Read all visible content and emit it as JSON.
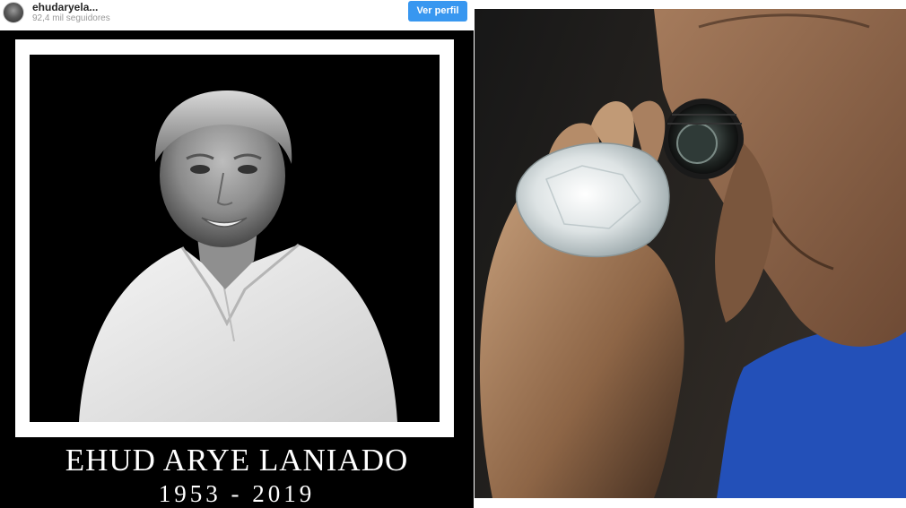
{
  "instagram_header": {
    "username": "ehudaryela...",
    "followers": "92,4 mil seguidores",
    "profile_button": "Ver perfil",
    "accent_color": "#3897f0"
  },
  "memorial": {
    "name": "EHUD ARYE LANIADO",
    "years": "1953 - 2019",
    "background_color": "#000000"
  },
  "icons": {
    "avatar": "profile-avatar-icon"
  }
}
